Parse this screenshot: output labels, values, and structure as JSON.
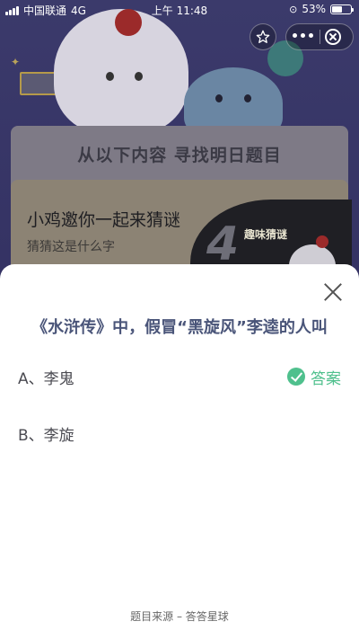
{
  "status_bar": {
    "carrier": "中国联通",
    "network": "4G",
    "time": "上午 11:48",
    "battery": "53%",
    "battery_level": 0.53
  },
  "capsule_menu": {
    "favorite_icon": "star-icon",
    "more_icon": "more-dots-icon",
    "close_icon": "close-circle-icon"
  },
  "background": {
    "card_title": "从以下内容 寻找明日题目",
    "card_heading": "小鸡邀你一起来猜谜",
    "card_subtitle": "猜猜这是什么字",
    "thumb_label": "趣味猜谜",
    "thumb_glyph": "4"
  },
  "sheet": {
    "question": "《水浒传》中，假冒“黑旋风”李逵的人叫",
    "options": [
      {
        "label": "A、李鬼",
        "is_answer": true
      },
      {
        "label": "B、李旋",
        "is_answer": false
      }
    ],
    "answer_label": "答案",
    "footer": "题目来源 – 答答星球"
  }
}
